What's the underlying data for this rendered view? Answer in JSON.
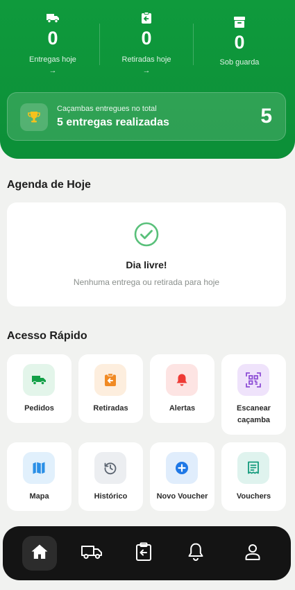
{
  "stats": [
    {
      "value": "0",
      "label": "Entregas hoje",
      "arrow": "→",
      "icon": "truck-icon"
    },
    {
      "value": "0",
      "label": "Retiradas hoje",
      "arrow": "→",
      "icon": "pickup-clipboard-icon"
    },
    {
      "value": "0",
      "label": "Sob guarda",
      "icon": "archive-box-icon"
    }
  ],
  "total_card": {
    "caption": "Caçambas entregues no total",
    "headline": "5 entregas realizadas",
    "count": "5",
    "icon": "trophy-icon"
  },
  "agenda": {
    "title": "Agenda de Hoje",
    "status": "Dia livre!",
    "message": "Nenhuma entrega ou retirada para hoje",
    "icon": "check-circle-icon"
  },
  "quick_access": {
    "title": "Acesso Rápido",
    "items": [
      {
        "label": "Pedidos",
        "icon": "truck-icon",
        "color": "#12a047"
      },
      {
        "label": "Retiradas",
        "icon": "pickup-clipboard-icon",
        "color": "#f08a24"
      },
      {
        "label": "Alertas",
        "icon": "bell-icon",
        "color": "#ee3a35"
      },
      {
        "label": "Escanear caçamba",
        "icon": "qr-scan-icon",
        "color": "#8e4fd6"
      },
      {
        "label": "Mapa",
        "icon": "map-icon",
        "color": "#2a8fe6"
      },
      {
        "label": "Histórico",
        "icon": "history-icon",
        "color": "#5b6470"
      },
      {
        "label": "Novo Voucher",
        "icon": "plus-circle-icon",
        "color": "#1f78e6"
      },
      {
        "label": "Vouchers",
        "icon": "receipt-icon",
        "color": "#139a7c"
      }
    ]
  },
  "nav": [
    {
      "name": "nav-home",
      "icon": "home-icon",
      "active": true
    },
    {
      "name": "nav-deliveries",
      "icon": "truck-icon",
      "active": false
    },
    {
      "name": "nav-pickups",
      "icon": "pickup-clipboard-icon",
      "active": false
    },
    {
      "name": "nav-alerts",
      "icon": "bell-icon",
      "active": false
    },
    {
      "name": "nav-profile",
      "icon": "user-icon",
      "active": false
    }
  ],
  "colors": {
    "brand_green": "#0f9a3c",
    "background": "#f1f2f0",
    "nav_bg": "#141414"
  }
}
